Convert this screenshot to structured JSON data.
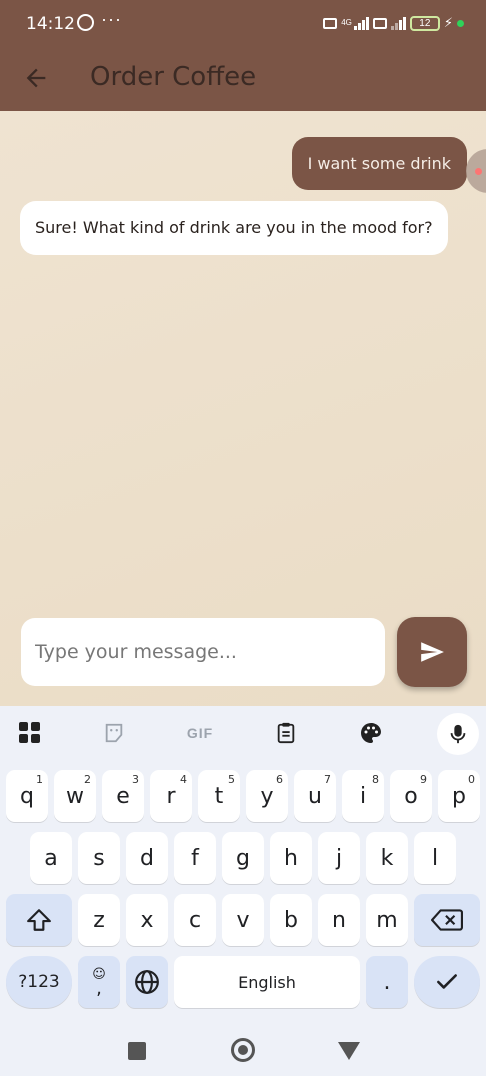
{
  "status_bar": {
    "time": "14:12",
    "notification_icons": [
      "whatsapp-icon",
      "more-dots-icon"
    ],
    "network_label": "4G",
    "battery_level": "12",
    "charging": true
  },
  "app_bar": {
    "title": "Order Coffee",
    "back_icon": "arrow-left-icon"
  },
  "chat": {
    "messages": [
      {
        "sender": "user",
        "text": "I want some drink"
      },
      {
        "sender": "bot",
        "text": "Sure! What kind of drink are you in the mood for?"
      }
    ],
    "input": {
      "value": "",
      "placeholder": "Type your message..."
    },
    "send_icon": "send-icon"
  },
  "keyboard": {
    "toolbar": {
      "apps_icon": "grid-icon",
      "sticker_icon": "sticker-icon",
      "gif_label": "GIF",
      "clipboard_icon": "clipboard-icon",
      "theme_icon": "palette-icon",
      "mic_icon": "mic-icon"
    },
    "row1": [
      "q",
      "w",
      "e",
      "r",
      "t",
      "y",
      "u",
      "i",
      "o",
      "p"
    ],
    "row1_hints": [
      "1",
      "2",
      "3",
      "4",
      "5",
      "6",
      "7",
      "8",
      "9",
      "0"
    ],
    "row2": [
      "a",
      "s",
      "d",
      "f",
      "g",
      "h",
      "j",
      "k",
      "l"
    ],
    "row3": [
      "z",
      "x",
      "c",
      "v",
      "b",
      "n",
      "m"
    ],
    "symbols_label": "?123",
    "emoji_comma_label": ",",
    "space_label": "English",
    "period_label": ".",
    "colors": {
      "key": "#ffffff",
      "modifier_key": "#d9e3f6",
      "background": "#eef1f8"
    }
  },
  "theme": {
    "brand_brown": "#7b5546",
    "chat_background": "#efe3d1"
  }
}
